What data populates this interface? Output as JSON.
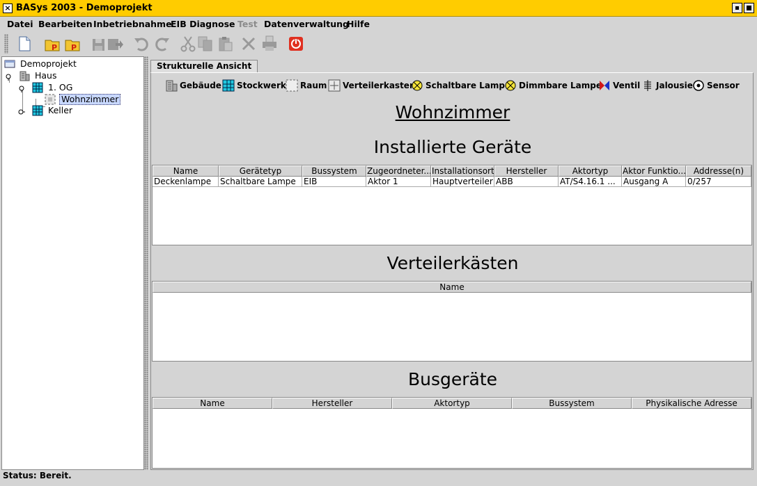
{
  "window": {
    "title": "BASys 2003 - Demoprojekt",
    "close_glyph": "×"
  },
  "menu": {
    "items": [
      {
        "label": "Datei"
      },
      {
        "label": "Bearbeiten"
      },
      {
        "label": "Inbetriebnahme"
      },
      {
        "label": "EIB Diagnose"
      },
      {
        "label": "Test",
        "disabled": true
      },
      {
        "label": "Datenverwaltung"
      },
      {
        "label": "Hilfe"
      }
    ]
  },
  "toolbar": {
    "icons": [
      "new-document-icon",
      "open-project-icon",
      "open-project-alt-icon",
      "save-icon",
      "save-as-icon",
      "undo-icon",
      "redo-icon",
      "cut-icon",
      "copy-icon",
      "paste-icon",
      "delete-icon",
      "print-icon",
      "exit-icon"
    ]
  },
  "tree": {
    "root": "Demoprojekt",
    "building": "Haus",
    "floor": "1. OG",
    "room": "Wohnzimmer",
    "floor2": "Keller"
  },
  "tabs": {
    "structural": "Strukturelle Ansicht"
  },
  "legend": {
    "items": [
      {
        "label": "Gebäude",
        "icon": "building-icon"
      },
      {
        "label": "Stockwerk",
        "icon": "floor-icon"
      },
      {
        "label": "Raum",
        "icon": "room-icon"
      },
      {
        "label": "Verteilerkasten",
        "icon": "distribution-box-icon"
      },
      {
        "label": "Schaltbare Lampe",
        "icon": "switchable-lamp-icon"
      },
      {
        "label": "Dimmbare Lampe",
        "icon": "dimmable-lamp-icon"
      },
      {
        "label": "Ventil",
        "icon": "valve-icon"
      },
      {
        "label": "Jalousie",
        "icon": "blind-icon"
      },
      {
        "label": "Sensor",
        "icon": "sensor-icon"
      }
    ]
  },
  "room": {
    "title": "Wohnzimmer"
  },
  "installed": {
    "title": "Installierte Geräte",
    "columns": [
      "Name",
      "Gerätetyp",
      "Bussystem",
      "Zugeordneter...",
      "Installationsort",
      "Hersteller",
      "Aktortyp",
      "Aktor Funktio...",
      "Addresse(n)"
    ],
    "rows": [
      [
        "Deckenlampe",
        "Schaltbare Lampe",
        "EIB",
        "Aktor 1",
        "Hauptverteiler",
        "ABB",
        "AT/S4.16.1 ...",
        "Ausgang A",
        "0/257"
      ]
    ]
  },
  "boxes": {
    "title": "Verteilerkästen",
    "columns": [
      "Name"
    ]
  },
  "bus": {
    "title": "Busgeräte",
    "columns": [
      "Name",
      "Hersteller",
      "Aktortyp",
      "Bussystem",
      "Physikalische Adresse"
    ]
  },
  "status": {
    "text": "Status: Bereit."
  },
  "colors": {
    "titlebar": "#ffcc00",
    "selection": "#c8d8ff",
    "exit_red": "#e03020",
    "floor_cyan": "#20c8e0"
  }
}
